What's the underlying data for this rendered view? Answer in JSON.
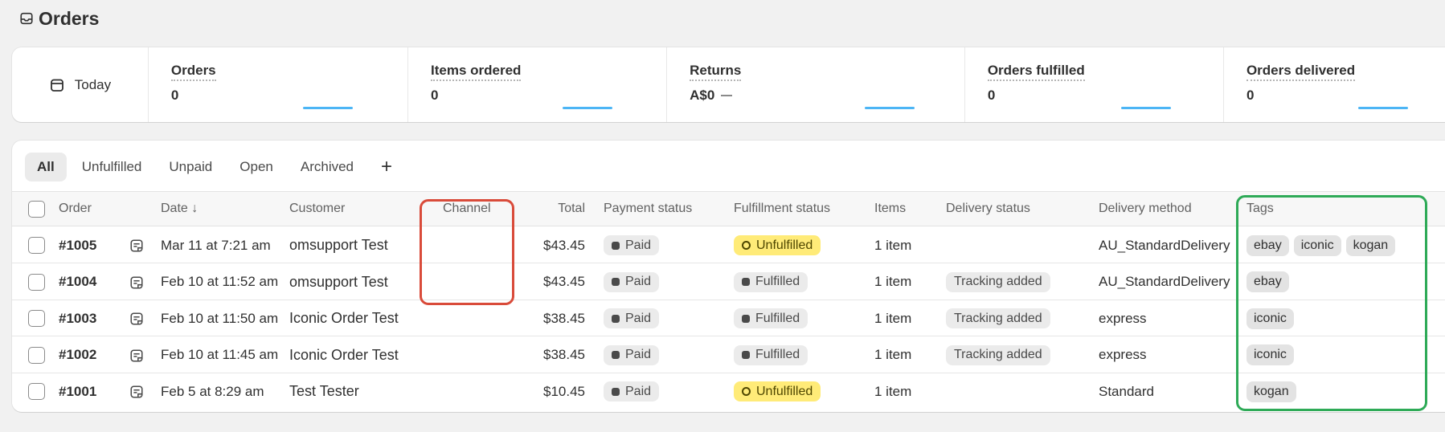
{
  "page": {
    "title": "Orders",
    "title_icon": "inbox-icon"
  },
  "metrics": {
    "date_label": "Today",
    "items": [
      {
        "label": "Orders",
        "value": "0"
      },
      {
        "label": "Items ordered",
        "value": "0"
      },
      {
        "label": "Returns",
        "value": "A$0"
      },
      {
        "label": "Orders fulfilled",
        "value": "0"
      },
      {
        "label": "Orders delivered",
        "value": "0"
      }
    ]
  },
  "tabs": [
    "All",
    "Unfulfilled",
    "Unpaid",
    "Open",
    "Archived"
  ],
  "tab_add_label": "+",
  "columns": {
    "order": "Order",
    "date": "Date ↓",
    "customer": "Customer",
    "channel": "Channel",
    "total": "Total",
    "payment": "Payment status",
    "fulfillment": "Fulfillment status",
    "items": "Items",
    "delivery": "Delivery status",
    "method": "Delivery method",
    "tags": "Tags"
  },
  "rows": [
    {
      "order": "#1005",
      "date": "Mar 11 at 7:21 am",
      "customer": "omsupport Test",
      "channel": "",
      "total": "$43.45",
      "payment": "Paid",
      "fulfillment": "Unfulfilled",
      "items": "1 item",
      "delivery": "",
      "method": "AU_StandardDelivery",
      "tags": [
        "ebay",
        "iconic",
        "kogan"
      ]
    },
    {
      "order": "#1004",
      "date": "Feb 10 at 11:52 am",
      "customer": "omsupport Test",
      "channel": "",
      "total": "$43.45",
      "payment": "Paid",
      "fulfillment": "Fulfilled",
      "items": "1 item",
      "delivery": "Tracking added",
      "method": "AU_StandardDelivery",
      "tags": [
        "ebay"
      ]
    },
    {
      "order": "#1003",
      "date": "Feb 10 at 11:50 am",
      "customer": "Iconic Order Test",
      "channel": "",
      "total": "$38.45",
      "payment": "Paid",
      "fulfillment": "Fulfilled",
      "items": "1 item",
      "delivery": "Tracking added",
      "method": "express",
      "tags": [
        "iconic"
      ]
    },
    {
      "order": "#1002",
      "date": "Feb 10 at 11:45 am",
      "customer": "Iconic Order Test",
      "channel": "",
      "total": "$38.45",
      "payment": "Paid",
      "fulfillment": "Fulfilled",
      "items": "1 item",
      "delivery": "Tracking added",
      "method": "express",
      "tags": [
        "iconic"
      ]
    },
    {
      "order": "#1001",
      "date": "Feb 5 at 8:29 am",
      "customer": "Test Tester",
      "channel": "",
      "total": "$10.45",
      "payment": "Paid",
      "fulfillment": "Unfulfilled",
      "items": "1 item",
      "delivery": "",
      "method": "Standard",
      "tags": [
        "kogan"
      ]
    }
  ],
  "colors": {
    "highlight_channel": "#d94b3a",
    "highlight_tags": "#2eaa57",
    "unfulfilled_badge": "#ffeb78",
    "sparkline": "#4cb5f5"
  }
}
